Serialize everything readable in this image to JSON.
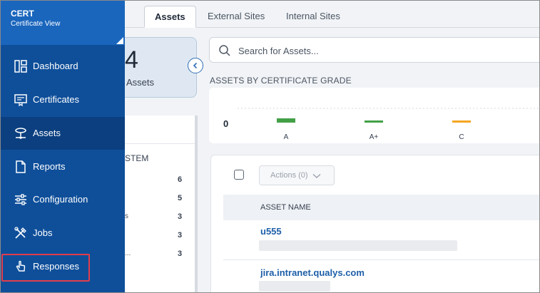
{
  "app": {
    "title": "CERT",
    "subtitle": "Certificate View"
  },
  "sidebar": {
    "items": [
      {
        "label": "Dashboard",
        "icon": "dashboard-icon"
      },
      {
        "label": "Certificates",
        "icon": "certificate-icon"
      },
      {
        "label": "Assets",
        "icon": "assets-icon",
        "active": true
      },
      {
        "label": "Reports",
        "icon": "reports-icon"
      },
      {
        "label": "Configuration",
        "icon": "sliders-icon"
      },
      {
        "label": "Jobs",
        "icon": "tools-icon"
      },
      {
        "label": "Responses",
        "icon": "pointer-hand-icon",
        "highlighted": true
      }
    ]
  },
  "tabs": [
    {
      "label": "Assets",
      "active": true
    },
    {
      "label": "External Sites"
    },
    {
      "label": "Internal Sites"
    }
  ],
  "summary": {
    "count": "4",
    "label": "Assets"
  },
  "search": {
    "placeholder": "Search for Assets..."
  },
  "grade_chart": {
    "title": "ASSETS BY CERTIFICATE GRADE",
    "zero_label": "0",
    "grades": [
      {
        "label": "A",
        "color": "#43a047"
      },
      {
        "label": "A+",
        "color": "#43a047"
      },
      {
        "label": "C",
        "color": "#f5a623"
      }
    ]
  },
  "os_panel": {
    "title_fragment": "STEM",
    "rows": [
      {
        "name": "",
        "count": "6"
      },
      {
        "name": "",
        "count": "5"
      },
      {
        "name": "s",
        "count": "3"
      },
      {
        "name": "",
        "count": "3"
      },
      {
        "name": "...",
        "count": "3"
      }
    ]
  },
  "table": {
    "actions_label": "Actions (0)",
    "column_header": "ASSET NAME",
    "rows": [
      {
        "name": "u555"
      },
      {
        "name": "jira.intranet.qualys.com"
      }
    ]
  },
  "colors": {
    "sidebar": "#0f4f9a",
    "sidebar_active": "#0b3f80",
    "accent": "#1d5fa8",
    "highlight": "#e23d4b"
  }
}
